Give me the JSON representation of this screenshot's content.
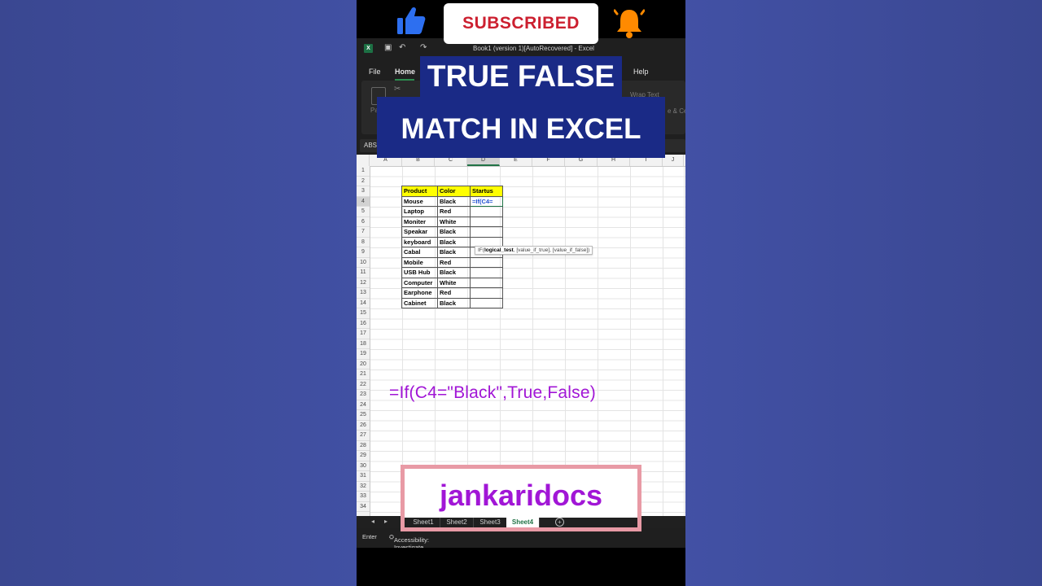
{
  "banner": {
    "subscribed_label": "SUBSCRIBED",
    "title_line1": "TRUE FALSE",
    "title_line2": "MATCH IN EXCEL",
    "brand": "jankaridocs",
    "colors": {
      "subscribe_text": "#cc1f2f",
      "title_bg": "#1a2a86",
      "brand": "#a116d6",
      "like": "#2d6ff0",
      "bell": "#ff8a00"
    }
  },
  "excel": {
    "window_title": "Book1 (version 1)[AutoRecovered]  -  Excel",
    "menu": [
      "File",
      "Home",
      "Help"
    ],
    "active_menu": "Home",
    "ribbon": {
      "paste": "Pa",
      "wrap_text": "Wrap Text",
      "merge_center": "e & Cente"
    },
    "name_box": "ABS",
    "columns": [
      "A",
      "B",
      "C",
      "D",
      "E",
      "F",
      "G",
      "H",
      "I",
      "J"
    ],
    "rows": [
      "1",
      "2",
      "3",
      "4",
      "5",
      "6",
      "7",
      "8",
      "9",
      "10",
      "11",
      "12",
      "13",
      "14",
      "15",
      "16",
      "17",
      "18",
      "19",
      "20",
      "21",
      "22",
      "23",
      "24",
      "25",
      "26",
      "27",
      "28",
      "29",
      "30",
      "31",
      "32",
      "33",
      "34"
    ],
    "table": {
      "headers": [
        "Product",
        "Color",
        "Startus"
      ],
      "rows": [
        [
          "Mouse",
          "Black",
          "=If(C4="
        ],
        [
          "Laptop",
          "Red",
          ""
        ],
        [
          "Moniter",
          "White",
          ""
        ],
        [
          "Speakar",
          "Black",
          ""
        ],
        [
          "keyboard",
          "Black",
          ""
        ],
        [
          "Cabal",
          "Black",
          ""
        ],
        [
          "Mobile",
          "Red",
          ""
        ],
        [
          "USB Hub",
          "Black",
          ""
        ],
        [
          "Computer",
          "White",
          ""
        ],
        [
          "Earphone",
          "Red",
          ""
        ],
        [
          "Cabinet",
          "Black",
          ""
        ]
      ]
    },
    "tooltip": {
      "fn": "IF(",
      "arg1": "logical_test",
      "rest": ", [value_if_true], [value_if_false])"
    },
    "formula_overlay": "=If(C4=\"Black\",True,False)",
    "sheets": [
      "Sheet1",
      "Sheet2",
      "Sheet3",
      "Sheet4"
    ],
    "active_sheet": "Sheet4",
    "status": {
      "mode": "Enter",
      "accessibility": "Accessibility: Investigate"
    }
  }
}
